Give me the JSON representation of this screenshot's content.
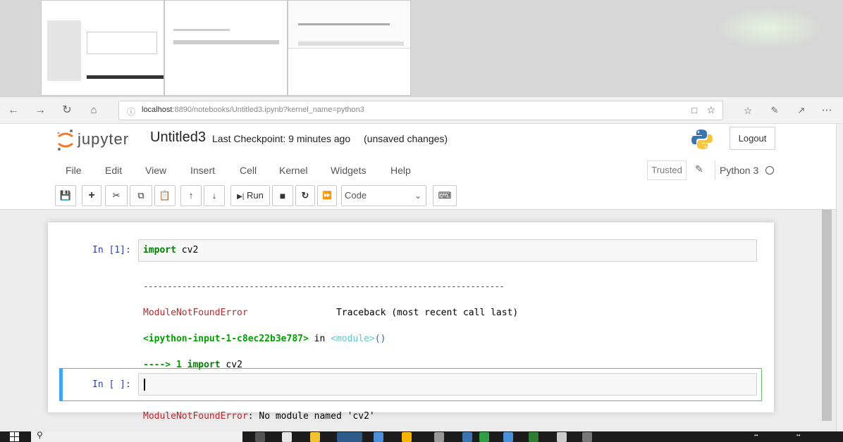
{
  "browser": {
    "url_host": "localhost",
    "url_path": ":8890/notebooks/Untitled3.ipynb?kernel_name=python3"
  },
  "header": {
    "logo_text": "jupyter",
    "notebook_title": "Untitled3",
    "checkpoint": "Last Checkpoint: 9 minutes ago",
    "status": "(unsaved changes)",
    "logout_label": "Logout"
  },
  "menubar": {
    "items": [
      "File",
      "Edit",
      "View",
      "Insert",
      "Cell",
      "Kernel",
      "Widgets",
      "Help"
    ],
    "trusted": "Trusted",
    "kernel": "Python 3"
  },
  "toolbar": {
    "run_label": "Run",
    "cell_type": "Code"
  },
  "cells": [
    {
      "prompt": "In [1]:",
      "code_keyword": "import",
      "code_rest": " cv2",
      "output": {
        "dashes": "---------------------------------------------------------------------------",
        "error_name": "ModuleNotFoundError",
        "traceback_header": "Traceback (most recent call last)",
        "input_ref": "<ipython-input-1-c8ec22b3e787>",
        "in_word": " in ",
        "module_ref": "<module>",
        "parens": "()",
        "arrow": "----> 1 ",
        "arrow_code_kw": "import",
        "arrow_code_rest": " cv2",
        "error_msg_name": "ModuleNotFoundError",
        "error_msg": ": No module named 'cv2'"
      }
    },
    {
      "prompt": "In [ ]:"
    }
  ],
  "colors": {
    "error_red": "#b22b31",
    "prompt_blue": "#303f9f",
    "keyword_green": "#008000",
    "edit_mode_green": "#66bb6a"
  }
}
